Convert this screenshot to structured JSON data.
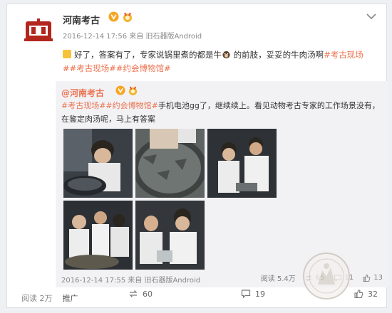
{
  "post": {
    "username": "河南考古",
    "meta": "2016-12-14 17:56 来自 旧石器版Android",
    "text_lead": "好了，答案有了，专家说锅里煮的都是牛",
    "text_mid": "的前肢，妥妥的牛肉汤啊",
    "hashtags": "#考古现场##考古现场##约会博物馆#"
  },
  "repost": {
    "username": "@河南考古",
    "hashtags": "#考古现场##约会博物馆#",
    "text": "手机电池gg了，继续续上。看见动物考古专家的工作场景没有，在鉴定肉汤呢，马上有答案",
    "meta": "2016-12-14 17:55 来自 旧石器版Android",
    "views": "阅读 5.4万",
    "reposts": "65",
    "comments": "11",
    "likes": "13"
  },
  "footer": {
    "reads": "阅读 2万",
    "promote": "推广",
    "reposts": "60",
    "comments": "19",
    "likes": "32"
  },
  "colors": {
    "accent": "#eb7350",
    "verified": "#f5a623",
    "repost_bg": "#f2f2f5"
  },
  "icons": [
    "avatar-logo-icon",
    "verified-icon",
    "medal-icon",
    "chevron-down-icon",
    "repost-icon",
    "comment-icon",
    "like-icon"
  ]
}
